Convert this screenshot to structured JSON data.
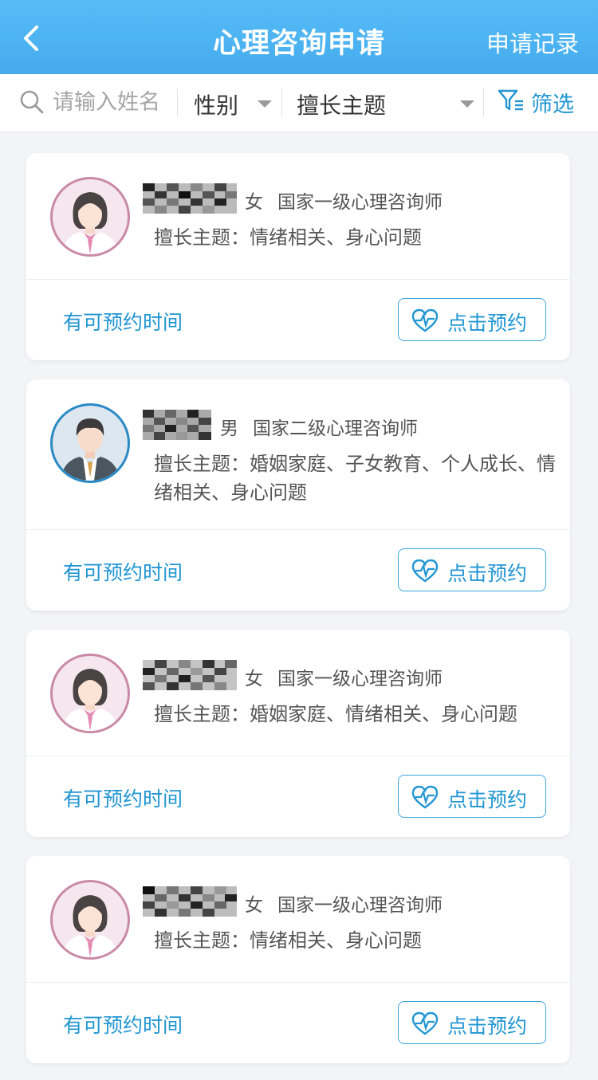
{
  "header": {
    "title": "心理咨询申请",
    "record_label": "申请记录"
  },
  "filter": {
    "search_placeholder": "请输入姓名",
    "gender_label": "性别",
    "topic_label": "擅长主题",
    "screen_label": "筛选"
  },
  "counselors": [
    {
      "gender": "女",
      "level": "国家一级心理咨询师",
      "topics": "擅长主题：情绪相关、身心问题",
      "availability": "有可预约时间",
      "button": "点击预约"
    },
    {
      "gender": "男",
      "level": "国家二级心理咨询师",
      "topics": "擅长主题：婚姻家庭、子女教育、个人成长、情绪相关、身心问题",
      "availability": "有可预约时间",
      "button": "点击预约"
    },
    {
      "gender": "女",
      "level": "国家一级心理咨询师",
      "topics": "擅长主题：婚姻家庭、情绪相关、身心问题",
      "availability": "有可预约时间",
      "button": "点击预约"
    },
    {
      "gender": "女",
      "level": "国家一级心理咨询师",
      "topics": "擅长主题：情绪相关、身心问题",
      "availability": "有可预约时间",
      "button": "点击预约"
    }
  ],
  "icons": [
    "back-arrow-icon",
    "search-icon",
    "caret-down-icon",
    "filter-funnel-icon",
    "heart-pulse-icon",
    "female-avatar",
    "male-avatar"
  ],
  "colors": {
    "header_gradient_top": "#56bdf6",
    "header_gradient_bottom": "#45abee",
    "accent": "#2196d3",
    "background": "#f2f4f8"
  }
}
